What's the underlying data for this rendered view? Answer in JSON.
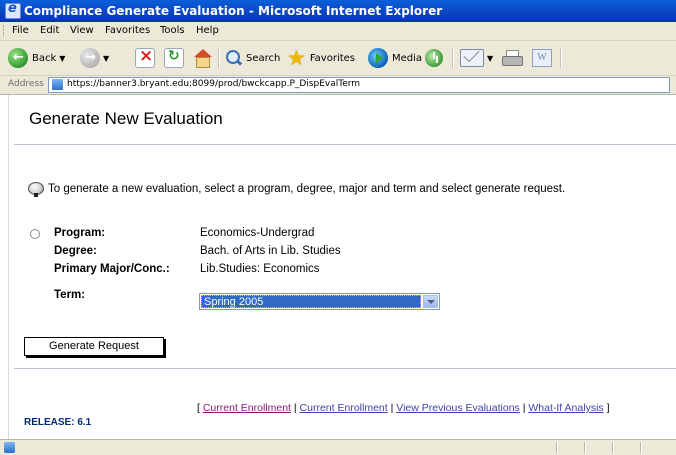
{
  "window": {
    "title": "Compliance Generate Evaluation - Microsoft Internet Explorer"
  },
  "menu": [
    "File",
    "Edit",
    "View",
    "Favorites",
    "Tools",
    "Help"
  ],
  "toolbar": {
    "back": "Back",
    "search": "Search",
    "favorites": "Favorites",
    "media": "Media",
    "word_icon": "W"
  },
  "address": {
    "label": "Address",
    "url": "https://banner3.bryant.edu:8099/prod/bwckcapp.P_DispEvalTerm"
  },
  "page": {
    "title": "Generate New Evaluation",
    "info": "To generate a new evaluation, select a program, degree, major and term and select generate request.",
    "program_label": "Program:",
    "program_value": "Economics-Undergrad",
    "degree_label": "Degree:",
    "degree_value": "Bach. of Arts in Lib. Studies",
    "major_label": "Primary Major/Conc.:",
    "major_value": "Lib.Studies: Economics",
    "term_label": "Term:",
    "term_value": "Spring 2005",
    "button": "Generate Request",
    "links": {
      "open": "[",
      "l1": "Current Enrollment",
      "sep": "|",
      "l2": "Current Enrollment",
      "l3": "View Previous Evaluations",
      "l4": "What-If Analysis",
      "close": "]"
    },
    "release": "RELEASE: 6.1"
  },
  "colors": {
    "titlebar": "#0a46c4",
    "selection": "#316ac5",
    "link": "#4040b0",
    "visited_link": "#8a1a7a"
  }
}
